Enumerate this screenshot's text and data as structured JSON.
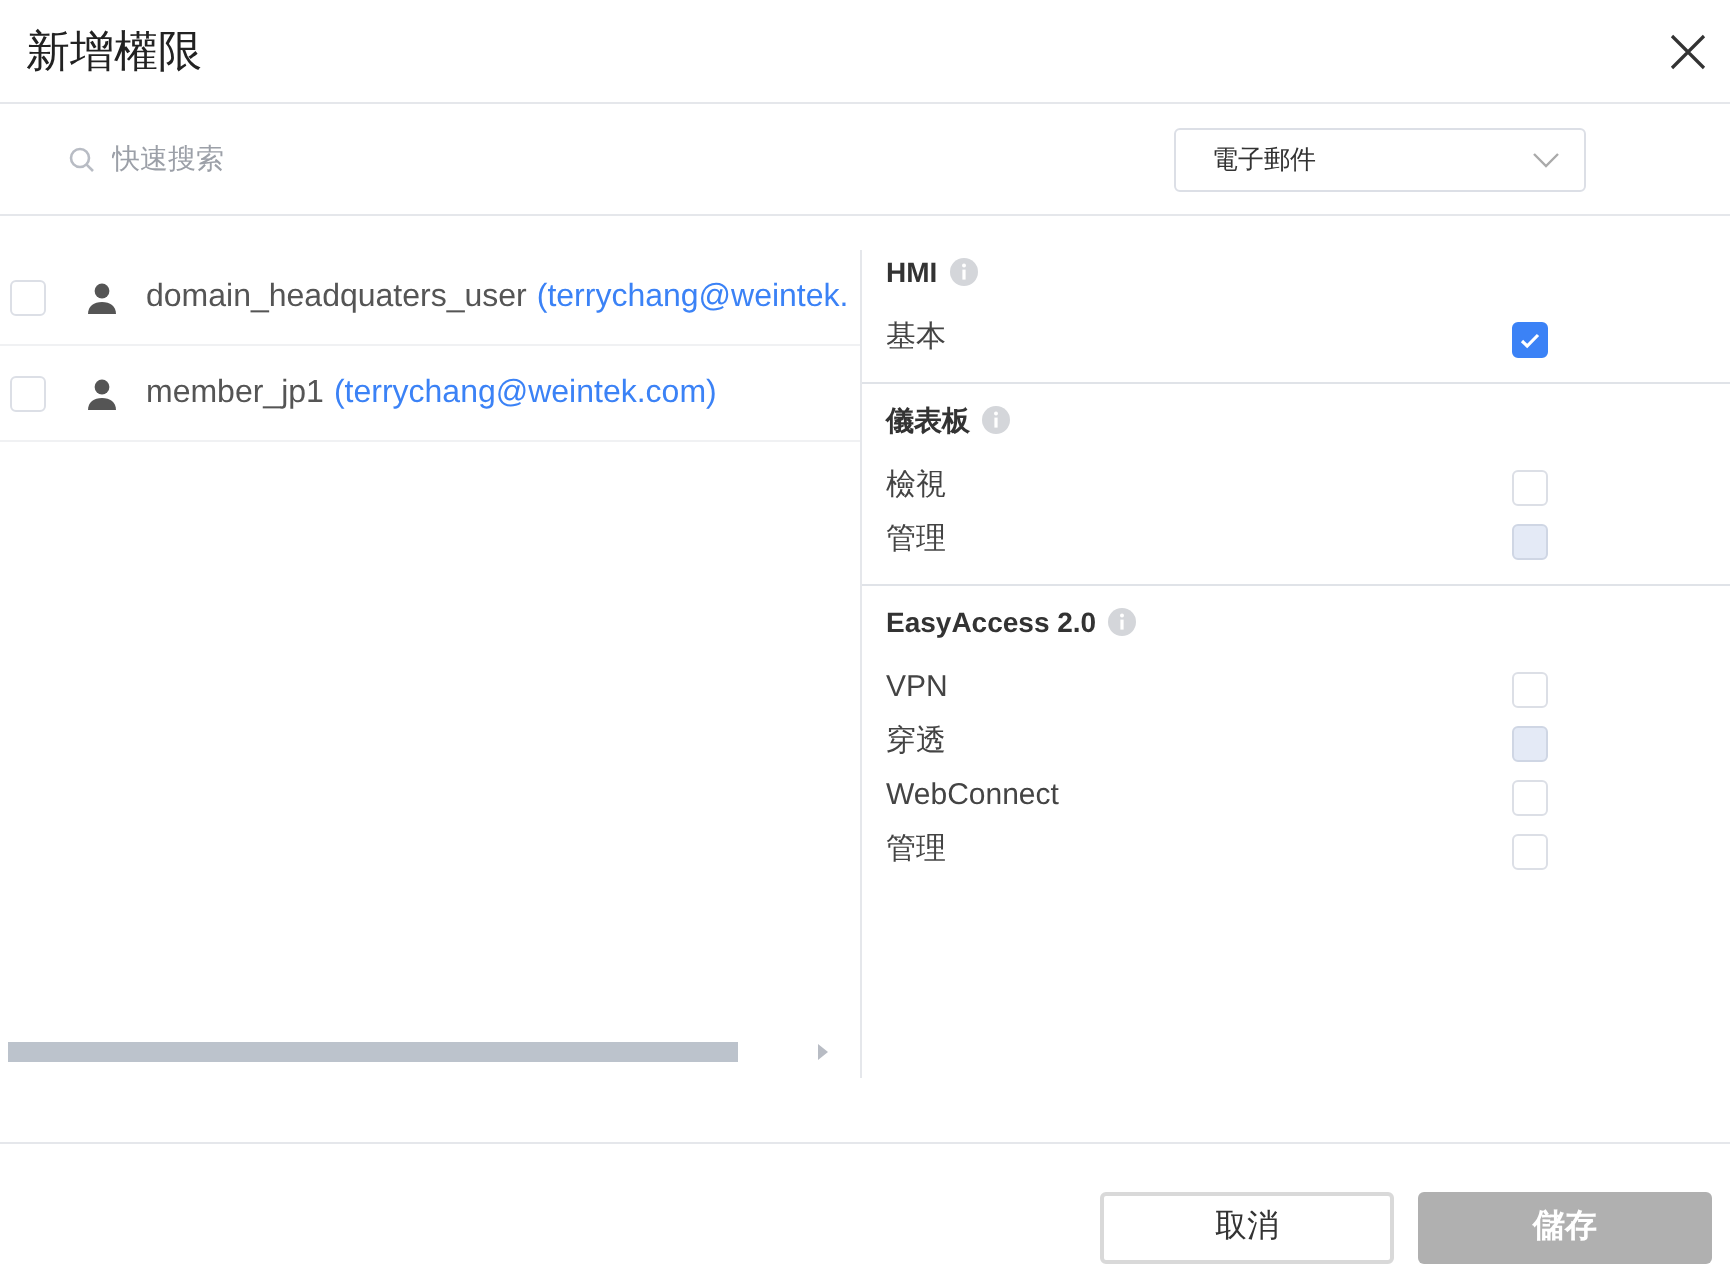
{
  "dialog": {
    "title": "新增權限"
  },
  "search": {
    "placeholder": "快速搜索"
  },
  "filter": {
    "value": "電子郵件"
  },
  "users": [
    {
      "name": "domain_headquaters_user",
      "email": "(terrychang@weintek.",
      "checked": false
    },
    {
      "name": "member_jp1",
      "email": "(terrychang@weintek.com)",
      "checked": false
    }
  ],
  "sections": [
    {
      "title": "HMI",
      "items": [
        {
          "label": "基本",
          "checked": true,
          "disabled": false
        }
      ]
    },
    {
      "title": "儀表板",
      "items": [
        {
          "label": "檢視",
          "checked": false,
          "disabled": false
        },
        {
          "label": "管理",
          "checked": false,
          "disabled": true
        }
      ]
    },
    {
      "title": "EasyAccess 2.0",
      "items": [
        {
          "label": "VPN",
          "checked": false,
          "disabled": false
        },
        {
          "label": "穿透",
          "checked": false,
          "disabled": true
        },
        {
          "label": "WebConnect",
          "checked": false,
          "disabled": false
        },
        {
          "label": "管理",
          "checked": false,
          "disabled": false
        }
      ]
    }
  ],
  "buttons": [
    {
      "label": "取消",
      "disabled": false
    },
    {
      "label": "儲存",
      "disabled": true
    }
  ]
}
